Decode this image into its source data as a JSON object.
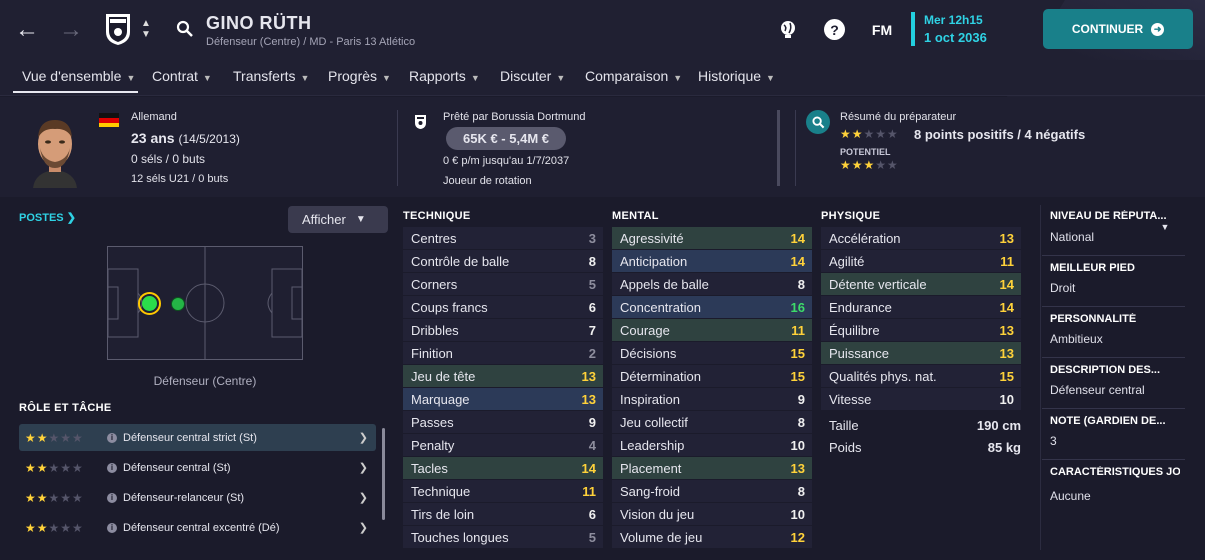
{
  "header": {
    "player_name": "GINO RÜTH",
    "subtitle": "Défenseur (Centre) / MD - Paris 13 Atlético",
    "fm_label": "FM",
    "date_line1": "Mer 12h15",
    "date_line2": "1 oct 2036",
    "continue_label": "CONTINUER"
  },
  "nav": {
    "items": [
      "Vue d'ensemble",
      "Contrat",
      "Transferts",
      "Progrès",
      "Rapports",
      "Discuter",
      "Comparaison",
      "Historique"
    ]
  },
  "profile": {
    "nationality": "Allemand",
    "age": "23 ans",
    "birthdate": "(14/5/2013)",
    "caps": "0 séls / 0 buts",
    "u21_caps": "12 séls U21 / 0 buts"
  },
  "loan": {
    "loaned_by": "Prêté par Borussia Dortmund",
    "value_range": "65K € - 5,4M €",
    "wage": "0 € p/m jusqu'au 1/7/2037",
    "status": "Joueur de rotation"
  },
  "coach": {
    "title": "Résumé du préparateur",
    "summary": "8 points positifs / 4 négatifs",
    "potential_label": "POTENTIEL",
    "ability_stars": 2,
    "potential_stars": 3
  },
  "positions": {
    "title": "POSTES",
    "afficher_label": "Afficher",
    "position_label": "Défenseur (Centre)"
  },
  "roles": {
    "title": "RÔLE ET TÂCHE",
    "items": [
      {
        "label": "Défenseur central strict (St)",
        "stars": 2
      },
      {
        "label": "Défenseur central (St)",
        "stars": 2
      },
      {
        "label": "Défenseur-relanceur (St)",
        "stars": 2
      },
      {
        "label": "Défenseur central excentré (Dé)",
        "stars": 2
      }
    ]
  },
  "technique": {
    "title": "TECHNIQUE",
    "attributes": [
      {
        "name": "Centres",
        "value": "3",
        "hl": ""
      },
      {
        "name": "Contrôle de balle",
        "value": "8",
        "hl": ""
      },
      {
        "name": "Corners",
        "value": "5",
        "hl": ""
      },
      {
        "name": "Coups francs",
        "value": "6",
        "hl": ""
      },
      {
        "name": "Dribbles",
        "value": "7",
        "hl": ""
      },
      {
        "name": "Finition",
        "value": "2",
        "hl": ""
      },
      {
        "name": "Jeu de tête",
        "value": "13",
        "hl": "g"
      },
      {
        "name": "Marquage",
        "value": "13",
        "hl": "b"
      },
      {
        "name": "Passes",
        "value": "9",
        "hl": ""
      },
      {
        "name": "Penalty",
        "value": "4",
        "hl": ""
      },
      {
        "name": "Tacles",
        "value": "14",
        "hl": "g"
      },
      {
        "name": "Technique",
        "value": "11",
        "hl": ""
      },
      {
        "name": "Tirs de loin",
        "value": "6",
        "hl": ""
      },
      {
        "name": "Touches longues",
        "value": "5",
        "hl": ""
      }
    ]
  },
  "mental": {
    "title": "MENTAL",
    "attributes": [
      {
        "name": "Agressivité",
        "value": "14",
        "hl": "g"
      },
      {
        "name": "Anticipation",
        "value": "14",
        "hl": "b"
      },
      {
        "name": "Appels de balle",
        "value": "8",
        "hl": ""
      },
      {
        "name": "Concentration",
        "value": "16",
        "hl": "b"
      },
      {
        "name": "Courage",
        "value": "11",
        "hl": "g"
      },
      {
        "name": "Décisions",
        "value": "15",
        "hl": ""
      },
      {
        "name": "Détermination",
        "value": "15",
        "hl": ""
      },
      {
        "name": "Inspiration",
        "value": "9",
        "hl": ""
      },
      {
        "name": "Jeu collectif",
        "value": "8",
        "hl": ""
      },
      {
        "name": "Leadership",
        "value": "10",
        "hl": ""
      },
      {
        "name": "Placement",
        "value": "13",
        "hl": "g"
      },
      {
        "name": "Sang-froid",
        "value": "8",
        "hl": ""
      },
      {
        "name": "Vision du jeu",
        "value": "10",
        "hl": ""
      },
      {
        "name": "Volume de jeu",
        "value": "12",
        "hl": ""
      }
    ]
  },
  "physique": {
    "title": "PHYSIQUE",
    "attributes": [
      {
        "name": "Accélération",
        "value": "13",
        "hl": ""
      },
      {
        "name": "Agilité",
        "value": "11",
        "hl": ""
      },
      {
        "name": "Détente verticale",
        "value": "14",
        "hl": "g"
      },
      {
        "name": "Endurance",
        "value": "14",
        "hl": ""
      },
      {
        "name": "Équilibre",
        "value": "13",
        "hl": ""
      },
      {
        "name": "Puissance",
        "value": "13",
        "hl": "g"
      },
      {
        "name": "Qualités phys. nat.",
        "value": "15",
        "hl": ""
      },
      {
        "name": "Vitesse",
        "value": "10",
        "hl": ""
      }
    ],
    "height_label": "Taille",
    "height": "190 cm",
    "weight_label": "Poids",
    "weight": "85 kg"
  },
  "side": [
    {
      "title": "NIVEAU DE RÉPUTA...",
      "value": "National"
    },
    {
      "title": "MEILLEUR PIED",
      "value": "Droit"
    },
    {
      "title": "PERSONNALITÉ",
      "value": "Ambitieux"
    },
    {
      "title": "DESCRIPTION DES...",
      "value": "Défenseur central"
    },
    {
      "title": "NOTE (GARDIEN DE...",
      "value": "3"
    },
    {
      "title": "CARACTÉRISTIQUES JO",
      "value": "Aucune"
    }
  ]
}
